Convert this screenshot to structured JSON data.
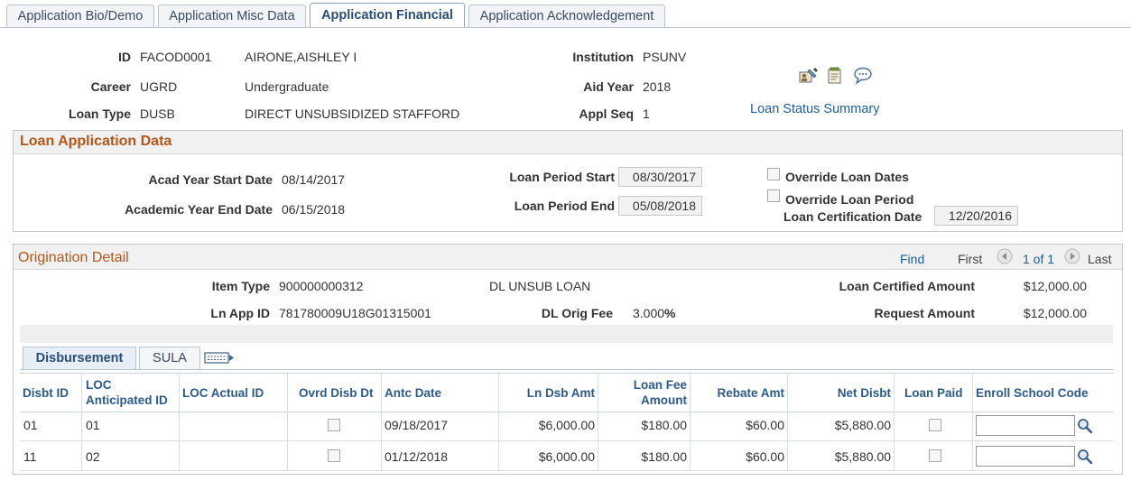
{
  "tabs": [
    {
      "label": "Application Bio/Demo",
      "active": false
    },
    {
      "label": "Application Misc Data",
      "active": false
    },
    {
      "label": "Application Financial",
      "active": true
    },
    {
      "label": "Application Acknowledgement",
      "active": false
    }
  ],
  "header": {
    "id_label": "ID",
    "id_value": "FACOD0001",
    "name": "AIRONE,AISHLEY I",
    "career_label": "Career",
    "career_code": "UGRD",
    "career_desc": "Undergraduate",
    "loan_type_label": "Loan Type",
    "loan_type_code": "DUSB",
    "loan_type_desc": "DIRECT UNSUBSIDIZED STAFFORD",
    "institution_label": "Institution",
    "institution_value": "PSUNV",
    "aid_year_label": "Aid Year",
    "aid_year_value": "2018",
    "appl_seq_label": "Appl Seq",
    "appl_seq_value": "1",
    "loan_status_link": "Loan Status Summary"
  },
  "loan_app": {
    "title": "Loan Application Data",
    "acad_start_label": "Acad Year Start Date",
    "acad_start_value": "08/14/2017",
    "acad_end_label": "Academic Year End Date",
    "acad_end_value": "06/15/2018",
    "period_start_label": "Loan Period Start",
    "period_start_value": "08/30/2017",
    "period_end_label": "Loan Period End",
    "period_end_value": "05/08/2018",
    "override_dates_label": "Override Loan Dates",
    "override_period_label": "Override Loan Period",
    "cert_date_label": "Loan Certification Date",
    "cert_date_value": "12/20/2016"
  },
  "origination": {
    "title": "Origination Detail",
    "find_label": "Find",
    "first_label": "First",
    "pager": "1 of 1",
    "last_label": "Last",
    "item_type_label": "Item Type",
    "item_type_value": "900000000312",
    "item_type_desc": "DL UNSUB LOAN",
    "ln_app_id_label": "Ln App ID",
    "ln_app_id_value": "781780009U18G01315001",
    "dl_orig_fee_label": "DL Orig Fee",
    "dl_orig_fee_value": "3.000",
    "dl_orig_fee_unit": "%",
    "cert_amt_label": "Loan Certified Amount",
    "cert_amt_value": "$12,000.00",
    "req_amt_label": "Request Amount",
    "req_amt_value": "$12,000.00"
  },
  "grid": {
    "tabs": [
      "Disbursement",
      "SULA"
    ],
    "columns": {
      "disb_id": "Disbt ID",
      "loc_ant_1": "LOC",
      "loc_ant_2": "Anticipated ID",
      "loc_actual": "LOC Actual ID",
      "ovrd": "Ovrd Disb Dt",
      "antc": "Antc Date",
      "dsb_amt": "Ln Dsb Amt",
      "fee_1": "Loan Fee",
      "fee_2": "Amount",
      "rebate": "Rebate Amt",
      "net": "Net Disbt",
      "paid": "Loan Paid",
      "school": "Enroll School Code"
    },
    "rows": [
      {
        "disb_id": "01",
        "loc_ant": "01",
        "loc_actual": "",
        "antc": "09/18/2017",
        "dsb_amt": "$6,000.00",
        "fee": "$180.00",
        "rebate": "$60.00",
        "net": "$5,880.00",
        "school": ""
      },
      {
        "disb_id": "11",
        "loc_ant": "02",
        "loc_actual": "",
        "antc": "01/12/2018",
        "dsb_amt": "$6,000.00",
        "fee": "$180.00",
        "rebate": "$60.00",
        "net": "$5,880.00",
        "school": ""
      }
    ]
  },
  "icons": [
    "person-edit-icon",
    "notepad-icon",
    "comment-icon",
    "previous-icon",
    "next-icon",
    "grid-view-icon",
    "lookup-icon"
  ]
}
